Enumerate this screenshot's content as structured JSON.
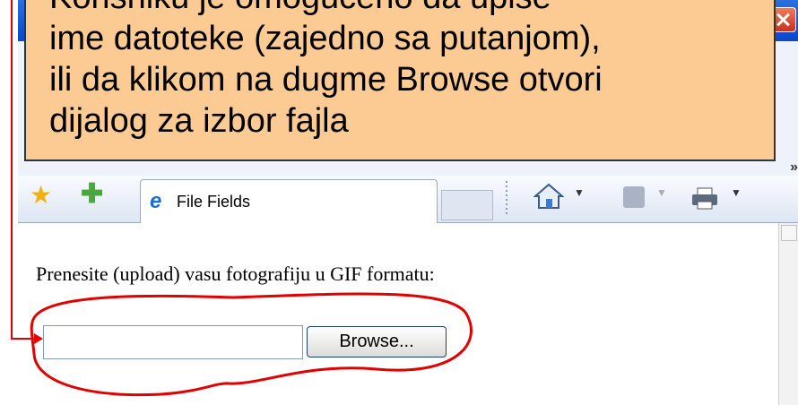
{
  "callout": {
    "lines": [
      "Korisniku je omogućeno da upiše",
      "ime datoteke (zajedno sa putanjom),",
      "ili da klikom na dugme Browse otvori",
      "dijalog za izbor fajla"
    ]
  },
  "tab": {
    "title": "File Fields"
  },
  "page": {
    "prompt": "Prenesite (upload) vasu fotografiju u GIF formatu:",
    "file_input_value": "",
    "browse_label": "Browse..."
  },
  "toolbar": {
    "chevron": "»"
  },
  "colors": {
    "callout_bg": "#fccb94",
    "annotation_red": "#e00000"
  },
  "icons": [
    "favorites-star-icon",
    "add-favorite-icon",
    "ie-page-icon",
    "home-icon",
    "feed-icon",
    "print-icon",
    "close-icon"
  ]
}
